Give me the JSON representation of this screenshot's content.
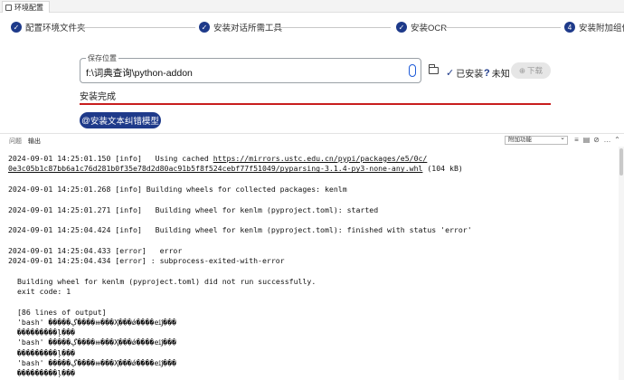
{
  "window": {
    "tab_title": "环境配置"
  },
  "steps": [
    {
      "num": "✓",
      "label": "配置环境文件夹"
    },
    {
      "num": "✓",
      "label": "安装对话所需工具"
    },
    {
      "num": "✓",
      "label": "安装OCR"
    },
    {
      "num": "4",
      "label": "安装附加组件"
    }
  ],
  "form": {
    "save_legend": "保存位置",
    "save_path": "f:\\词典查询\\python-addon",
    "installed_label": "已安装",
    "unknown_label": "未知",
    "download_label": "下载",
    "status_text": "安装完成",
    "install_button_label": "安装文本纠错模型"
  },
  "panel": {
    "tabs": [
      "问题",
      "输出"
    ],
    "filter_value": "附加功能"
  },
  "log_lines": [
    {
      "text": "2024-09-01 14:25:01.150 [info]   Using cached https://mirrors.ustc.edu.cn/pypi/packages/e5/0c/",
      "indent": false
    },
    {
      "text": "0e3c05b1c87bb6a1c76d281b0f35e78d2d80ac91b5f8f524cebf77f51049/pyparsing-3.1.4-py3-none-any.whl (104 kB)",
      "indent": false
    },
    {
      "text": "",
      "indent": false
    },
    {
      "text": "2024-09-01 14:25:01.268 [info] Building wheels for collected packages: kenlm",
      "indent": false
    },
    {
      "text": "",
      "indent": false
    },
    {
      "text": "2024-09-01 14:25:01.271 [info]   Building wheel for kenlm (pyproject.toml): started",
      "indent": false
    },
    {
      "text": "",
      "indent": false
    },
    {
      "text": "2024-09-01 14:25:04.424 [info]   Building wheel for kenlm (pyproject.toml): finished with status 'error'",
      "indent": false
    },
    {
      "text": "",
      "indent": false
    },
    {
      "text": "2024-09-01 14:25:04.433 [error]   error",
      "indent": false
    },
    {
      "text": "2024-09-01 14:25:04.434 [error] : subprocess-exited-with-error",
      "indent": false
    },
    {
      "text": "",
      "indent": false
    },
    {
      "text": "Building wheel for kenlm (pyproject.toml) did not run successfully.",
      "indent": true
    },
    {
      "text": "exit code: 1",
      "indent": true
    },
    {
      "text": "",
      "indent": false
    },
    {
      "text": "[86 lines of output]",
      "indent": true
    },
    {
      "text": "'bash' �����ڲ����ⲿ���Ҳ���ǿ����еĳ���",
      "indent": true
    },
    {
      "text": "���������ļ���",
      "indent": true
    },
    {
      "text": "'bash' �����ڲ����ⲿ���Ҳ���ǿ����еĳ���",
      "indent": true
    },
    {
      "text": "���������ļ���",
      "indent": true
    },
    {
      "text": "'bash' �����ڲ����ⲿ���Ҳ���ǿ����еĳ���",
      "indent": true
    },
    {
      "text": "���������ļ���",
      "indent": true
    }
  ],
  "colors": {
    "accent": "#1e3a8a",
    "error_line": "#c81e1e"
  }
}
